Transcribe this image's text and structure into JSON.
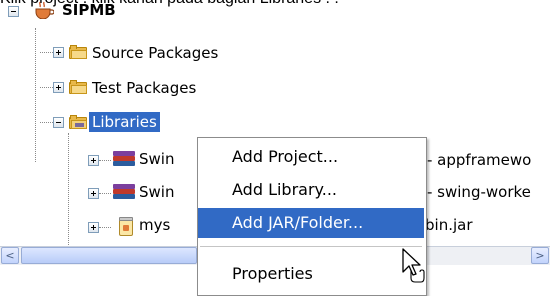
{
  "caption": "Klik project . klik kanan pada bagian Libraries . .",
  "tree": {
    "project": {
      "label": "SIPMB",
      "icon": "coffee-cup-icon"
    },
    "nodes": [
      {
        "label": "Source Packages",
        "icon": "folder-icon"
      },
      {
        "label": "Test Packages",
        "icon": "folder-icon"
      },
      {
        "label": "Libraries",
        "icon": "library-folder-icon",
        "selected": true
      },
      {
        "label": "Swin",
        "suffix": "- appframewo",
        "icon": "books-icon"
      },
      {
        "label": "Swin",
        "suffix": "- swing-worke",
        "icon": "books-icon"
      },
      {
        "label": "mys",
        "suffix": "bin.jar",
        "icon": "jar-icon"
      }
    ]
  },
  "context_menu": {
    "items": [
      {
        "label": "Add Project...",
        "active": false
      },
      {
        "label": "Add Library...",
        "active": false
      },
      {
        "label": "Add JAR/Folder...",
        "active": true
      },
      {
        "label": "Properties",
        "active": false
      }
    ]
  },
  "scrollbar": {
    "left_arrow": "<",
    "right_arrow": ">"
  },
  "colors": {
    "selection": "#316ac5",
    "folder": "#e8b84a",
    "scrollbar": "#c2d3fc"
  }
}
